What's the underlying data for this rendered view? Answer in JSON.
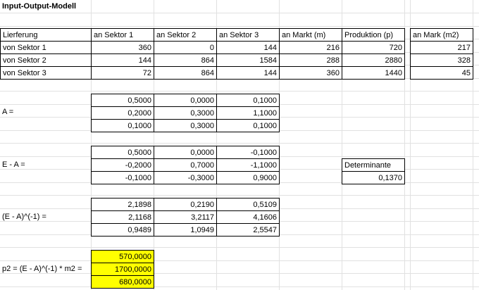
{
  "title": "Input-Output-Modell",
  "header": [
    "Lierferung",
    "an Sektor 1",
    "an Sektor 2",
    "an Sektor 3",
    "an Markt (m)",
    "Produktion (p)",
    "an Mark (m2)"
  ],
  "rows": [
    {
      "label": "von Sektor 1",
      "values": [
        "360",
        "0",
        "144",
        "216",
        "720"
      ],
      "m2": "217"
    },
    {
      "label": "von Sektor 2",
      "values": [
        "144",
        "864",
        "1584",
        "288",
        "2880"
      ],
      "m2": "328"
    },
    {
      "label": "von Sektor 3",
      "values": [
        "72",
        "864",
        "144",
        "360",
        "1440"
      ],
      "m2": "45"
    }
  ],
  "matrixA": {
    "label": "A =",
    "cells": [
      [
        "0,5000",
        "0,0000",
        "0,1000"
      ],
      [
        "0,2000",
        "0,3000",
        "1,1000"
      ],
      [
        "0,1000",
        "0,3000",
        "0,1000"
      ]
    ]
  },
  "matrixEA": {
    "label": "E - A =",
    "cells": [
      [
        "0,5000",
        "0,0000",
        "-0,1000"
      ],
      [
        "-0,2000",
        "0,7000",
        "-1,1000"
      ],
      [
        "-0,1000",
        "-0,3000",
        "0,9000"
      ]
    ]
  },
  "determinant": {
    "label": "Determinante",
    "value": "0,1370"
  },
  "matrixInv": {
    "label": "(E - A)^(-1) =",
    "cells": [
      [
        "2,1898",
        "0,2190",
        "0,5109"
      ],
      [
        "2,1168",
        "3,2117",
        "4,1606"
      ],
      [
        "0,9489",
        "1,0949",
        "2,5547"
      ]
    ]
  },
  "p2": {
    "label": "p2 = (E - A)^(-1) * m2 =",
    "values": [
      "570,0000",
      "1700,0000",
      "680,0000"
    ]
  }
}
